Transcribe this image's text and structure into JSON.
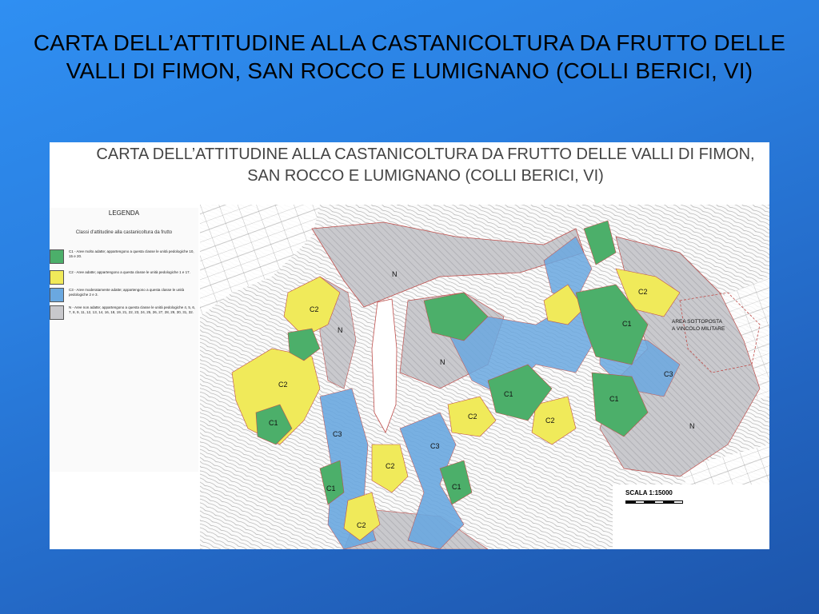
{
  "slide": {
    "title": "CARTA DELL’ATTITUDINE ALLA CASTANICOLTURA DA FRUTTO DELLE VALLI DI FIMON, SAN ROCCO E LUMIGNANO (COLLI BERICI, VI)"
  },
  "map": {
    "heading_line1": "CARTA DELL’ATTITUDINE ALLA CASTANICOLTURA DA FRUTTO DELLE VALLI DI FIMON,",
    "heading_line2": "SAN ROCCO E LUMIGNANO (COLLI BERICI, VI)",
    "scale": "SCALA 1:15000",
    "annotation_line1": "AREA SOTTOPOSTA",
    "annotation_line2": "A VINCOLO MILITARE",
    "zone_labels": {
      "c2_a": "C2",
      "c2_b": "C2",
      "c2_c": "C2",
      "c2_d": "C2",
      "c2_e": "C2",
      "c2_f": "C2",
      "c2_g": "C2",
      "c1_a": "C1",
      "c1_b": "C1",
      "c1_c": "C1",
      "c1_d": "C1",
      "c1_e": "C1",
      "c1_f": "C1",
      "c3_a": "C3",
      "c3_b": "C3",
      "c3_c": "C3",
      "n_a": "N",
      "n_b": "N",
      "n_c": "N",
      "n_d": "N"
    }
  },
  "legend": {
    "title": "LEGENDA",
    "subtitle": "Classi d'attitudine alla castanicoltura da frutto",
    "items": [
      {
        "color": "#4caf6a",
        "text": "C1 - Aree molto adatte; appartengono a questa classe le unità pedologiche 10, 15 e 20."
      },
      {
        "color": "#f0ea5a",
        "text": "C2 - Aree adatte; appartengono a questa classe le unità pedologiche 1 e 17."
      },
      {
        "color": "#6aa8e0",
        "text": "C3 - Aree moderatamente adatte; appartengono a questa classe le unità pedologiche 2 e 3."
      },
      {
        "color": "#c8c8cc",
        "text": "N - Aree non adatte; appartengono a questa classe le unità pedologiche 4, 5, 6, 7, 8, 9, 11, 12, 13, 14, 16, 18, 19, 21, 22, 23, 24, 25, 26, 27, 28, 29, 30, 31, 32."
      }
    ]
  }
}
